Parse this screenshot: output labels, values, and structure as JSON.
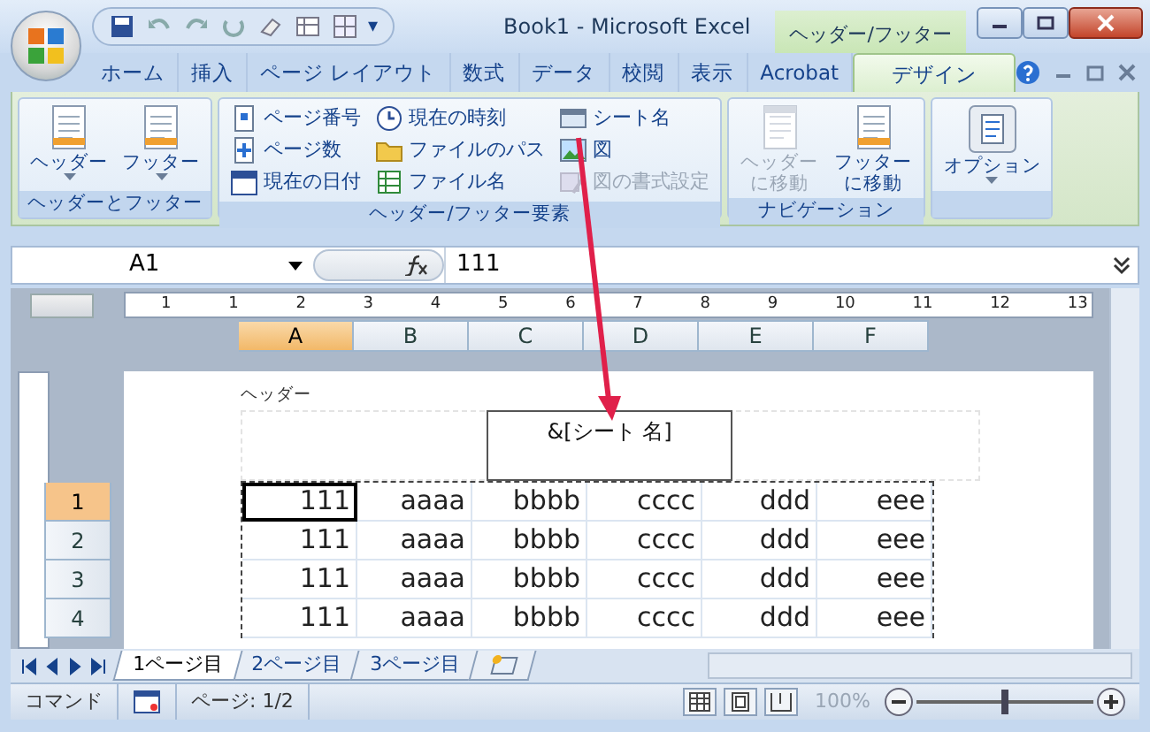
{
  "window": {
    "title": "Book1 - Microsoft Excel",
    "context_title": "ヘッダー/フッター"
  },
  "quick_access": {
    "more": "▾"
  },
  "ribbon_tabs": [
    {
      "label": "ホーム",
      "selected": false
    },
    {
      "label": "挿入",
      "selected": false
    },
    {
      "label": "ページ レイアウト",
      "selected": false
    },
    {
      "label": "数式",
      "selected": false
    },
    {
      "label": "データ",
      "selected": false
    },
    {
      "label": "校閲",
      "selected": false
    },
    {
      "label": "表示",
      "selected": false
    },
    {
      "label": "Acrobat",
      "selected": false
    },
    {
      "label": "デザイン",
      "selected": true
    }
  ],
  "ribbon_groups": [
    {
      "label": "ヘッダーとフッター",
      "buttons": [
        {
          "label": "ヘッダー",
          "kind": "large",
          "disabled": false
        },
        {
          "label": "フッター",
          "kind": "large",
          "disabled": false
        }
      ]
    },
    {
      "label": "ヘッダー/フッター要素",
      "buttons": [
        {
          "label": "ページ番号",
          "kind": "small",
          "disabled": false
        },
        {
          "label": "ページ数",
          "kind": "small",
          "disabled": false
        },
        {
          "label": "現在の日付",
          "kind": "small",
          "disabled": false
        },
        {
          "label": "現在の時刻",
          "kind": "small",
          "disabled": false
        },
        {
          "label": "ファイルのパス",
          "kind": "small",
          "disabled": false
        },
        {
          "label": "ファイル名",
          "kind": "small",
          "disabled": false
        },
        {
          "label": "シート名",
          "kind": "small",
          "disabled": false
        },
        {
          "label": "図",
          "kind": "small",
          "disabled": false
        },
        {
          "label": "図の書式設定",
          "kind": "small",
          "disabled": true
        }
      ]
    },
    {
      "label": "ナビゲーション",
      "buttons": [
        {
          "label": "ヘッダーに移動",
          "kind": "large",
          "disabled": true
        },
        {
          "label": "フッターに移動",
          "kind": "large",
          "disabled": false
        }
      ]
    },
    {
      "buttons": [
        {
          "label": "オプション",
          "kind": "large",
          "disabled": false
        }
      ]
    }
  ],
  "formula_bar": {
    "name_box": "A1",
    "value": "111"
  },
  "ruler": [
    "1",
    "1",
    "2",
    "3",
    "4",
    "5",
    "6",
    "7",
    "8",
    "9",
    "10",
    "11",
    "12",
    "13"
  ],
  "columns": [
    {
      "label": "A",
      "selected": true
    },
    {
      "label": "B",
      "selected": false
    },
    {
      "label": "C",
      "selected": false
    },
    {
      "label": "D",
      "selected": false
    },
    {
      "label": "E",
      "selected": false
    },
    {
      "label": "F",
      "selected": false
    }
  ],
  "page_header": {
    "label": "ヘッダー",
    "center": "&[シート 名]"
  },
  "rows": [
    {
      "label": "1",
      "selected": true,
      "cells": [
        "111",
        "aaaa",
        "bbbb",
        "cccc",
        "ddd",
        "eee"
      ]
    },
    {
      "label": "2",
      "selected": false,
      "cells": [
        "111",
        "aaaa",
        "bbbb",
        "cccc",
        "ddd",
        "eee"
      ]
    },
    {
      "label": "3",
      "selected": false,
      "cells": [
        "111",
        "aaaa",
        "bbbb",
        "cccc",
        "ddd",
        "eee"
      ]
    },
    {
      "label": "4",
      "selected": false,
      "cells": [
        "111",
        "aaaa",
        "bbbb",
        "cccc",
        "ddd",
        "eee"
      ]
    }
  ],
  "sheet_tabs": [
    {
      "label": "1ページ目",
      "selected": true
    },
    {
      "label": "2ページ目",
      "selected": false
    },
    {
      "label": "3ページ目",
      "selected": false
    }
  ],
  "status_bar": {
    "mode": "コマンド",
    "page": "ページ: 1/2",
    "zoom": "100%",
    "zoom_level": {
      "level": 0.5
    }
  }
}
